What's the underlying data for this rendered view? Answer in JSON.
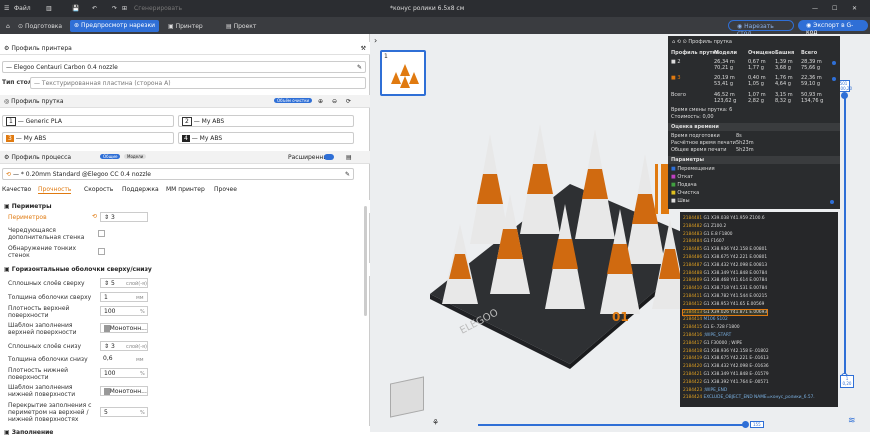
{
  "titlebar": {
    "file": "Файл",
    "undo_label": "Сгенерировать",
    "title": "*конус ролики 6.5x8 см"
  },
  "tabs": [
    "Подготовка",
    "Предпросмотр нарезки",
    "Принтер",
    "Проект"
  ],
  "buttons": {
    "slice": "Нарезать стол",
    "export": "Экспорт в G-код"
  },
  "printer": {
    "section": "Профиль принтера",
    "name": "Elegoo Centauri Carbon 0.4 nozzle",
    "bed_label": "Тип стола",
    "bed_value": "Текстурированная пластина (сторона А)"
  },
  "filament": {
    "section": "Профиль прутка",
    "badge": "Объём очистки",
    "slots": [
      {
        "n": "1",
        "name": "Generic PLA"
      },
      {
        "n": "2",
        "name": "My ABS"
      },
      {
        "n": "3",
        "name": "My ABS"
      },
      {
        "n": "4",
        "name": "My ABS"
      }
    ]
  },
  "process": {
    "section": "Профиль процесса",
    "mode_general": "Общие",
    "mode_models": "Модели",
    "advanced": "Расширенный",
    "preset": "* 0.20mm Standard @Elegoo CC 0.4 nozzle",
    "tabs": [
      "Качество",
      "Прочность",
      "Скорость",
      "Поддержка",
      "ММ принтер",
      "Прочее"
    ]
  },
  "perimeters": {
    "section": "Периметры",
    "rows": [
      {
        "label": "Периметров",
        "value": "3"
      },
      {
        "label": "Чередующаяся дополнительная стенка"
      },
      {
        "label": "Обнаружение тонких стенок"
      }
    ]
  },
  "shells": {
    "section": "Горизонтальные оболочки сверху/снизу",
    "rows": [
      {
        "label": "Сплошных слоёв сверху",
        "value": "5",
        "unit": "слой(-я)"
      },
      {
        "label": "Толщина оболочки сверху",
        "value": "1",
        "unit": "мм"
      },
      {
        "label": "Плотность верхней поверхности",
        "value": "100",
        "unit": "%"
      },
      {
        "label": "Шаблон заполнения верхней поверхности",
        "value": "Монотонн..."
      },
      {
        "label": "Сплошных слоёв снизу",
        "value": "3",
        "unit": "слой(-я)"
      },
      {
        "label": "Толщина оболочки снизу",
        "value": "0,6",
        "unit": "мм"
      },
      {
        "label": "Плотность нижней поверхности",
        "value": "100",
        "unit": "%"
      },
      {
        "label": "Шаблон заполнения нижней поверхности",
        "value": "Монотонн..."
      },
      {
        "label": "Перекрытие заполнения с периметром на верхней /нижней поверхностях",
        "value": "5",
        "unit": "%"
      }
    ],
    "next": "Заполнение"
  },
  "viewport": {
    "thumb_n": "1",
    "plate_number": "01",
    "layer_top": "501",
    "layer_top2": "100,20",
    "layer_bot": "1",
    "layer_bot2": "0,20",
    "progress": "155",
    "brand": "ELEGOO"
  },
  "stats": {
    "header": "Профиль прутка",
    "cols": [
      "Профиль прутка",
      "Модели",
      "Очищено",
      "Башня",
      "Всего"
    ],
    "rows": [
      {
        "id": "2",
        "c": [
          "26,34 m\n70,21 g",
          "0,67 m\n1,77 g",
          "1,39 m\n3,68 g",
          "28,39 m\n75,66 g"
        ]
      },
      {
        "id": "3",
        "c": [
          "20,19 m\n53,41 g",
          "0,40 m\n1,05 g",
          "1,76 m\n4,64 g",
          "22,36 m\n59,10 g"
        ]
      }
    ],
    "total": {
      "label": "Всего",
      "c": [
        "46,52 m\n123,62 g",
        "1,07 m\n2,82 g",
        "3,15 m\n8,32 g",
        "50,93 m\n134,76 g"
      ]
    },
    "swaps_label": "Время смены прутка:",
    "swaps": "6",
    "cost_label": "Стоимость:",
    "cost": "0,00",
    "time_head": "Оценка времени",
    "prep_label": "Время подготовки",
    "prep": "8s",
    "calc_label": "Расчётное время печати",
    "calc": "5h23m",
    "total_label": "Общее время печати",
    "total_t": "5h23m",
    "params_head": "Параметры",
    "params": [
      "Перемещения",
      "Откат",
      "Подача",
      "Очистка",
      "Швы"
    ]
  },
  "gcode": [
    {
      "n": "2184481",
      "t": "G1 X39.038 Y41.959 Z100.6"
    },
    {
      "n": "2184482",
      "t": "G1 Z100.2"
    },
    {
      "n": "2184483",
      "t": "G1 E.8 F1800"
    },
    {
      "n": "2184484",
      "t": "G1 F1607"
    },
    {
      "n": "2184485",
      "t": "G1 X38.936 Y42.158 E.00801"
    },
    {
      "n": "2184486",
      "t": "G1 X38.675 Y42.221 E.00801"
    },
    {
      "n": "2184487",
      "t": "G1 X38.432 Y42.098 E.00813"
    },
    {
      "n": "2184488",
      "t": "G1 X38.349 Y41.848 E.00784"
    },
    {
      "n": "2184489",
      "t": "G1 X38.468 Y41.614 E.00784"
    },
    {
      "n": "2184410",
      "t": "G1 X38.718 Y41.531 E.00784"
    },
    {
      "n": "2184411",
      "t": "G1 X38.782 Y41.544 E.00215"
    },
    {
      "n": "2184412",
      "t": "G1 X38.953 Y41.65 E.00569"
    },
    {
      "n": "2184413",
      "t": "G1 X39.026 Y41.871 E.00693"
    },
    {
      "n": "2184414",
      "t": "M106 S102"
    },
    {
      "n": "2184415",
      "t": "G1 E-.728 F1800"
    },
    {
      "n": "2184416",
      "t": ";WIPE_START"
    },
    {
      "n": "2184417",
      "t": "G1 F30000 ; WIPE"
    },
    {
      "n": "2184418",
      "t": "G1 X38.936 Y42.158 E-.01802"
    },
    {
      "n": "2184419",
      "t": "G1 X38.675 Y42.221 E-.01613"
    },
    {
      "n": "2184420",
      "t": "G1 X38.432 Y42.098 E-.01636"
    },
    {
      "n": "2184421",
      "t": "G1 X38.349 Y41.848 E-.01579"
    },
    {
      "n": "2184422",
      "t": "G1 X38.392 Y41.764 E-.00571"
    },
    {
      "n": "2184423",
      "t": ";WIPE_END"
    },
    {
      "n": "2184424",
      "t": "EXCLUDE_OBJECT_END NAME=конус_ролики_6.57."
    }
  ],
  "colors": {
    "accent": "#2f6fd6",
    "orange": "#e07a10",
    "panel_dark": "#2a2c2e"
  },
  "icons": [
    "menu-icon",
    "save-icon",
    "undo-icon",
    "redo-icon",
    "gear-icon",
    "eye-icon",
    "printer-icon",
    "layers-icon"
  ]
}
